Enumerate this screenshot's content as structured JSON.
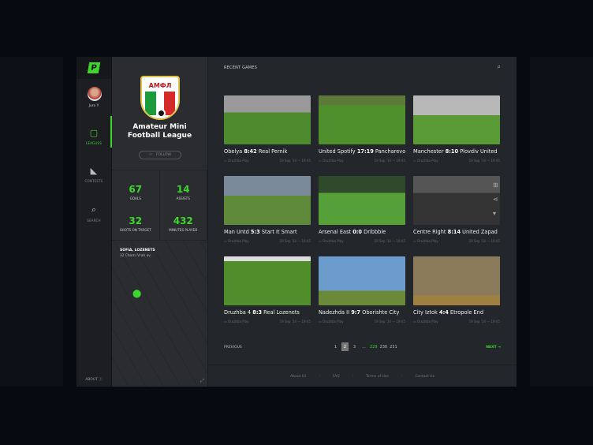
{
  "user": {
    "name": "Juro Y"
  },
  "nav": {
    "leagues": "LEAGUES",
    "contests": "CONTESTS",
    "search": "SEARCH",
    "about": "ABOUT"
  },
  "league": {
    "name_line1": "Amateur Mini",
    "name_line2": "Football League",
    "crest_text": "АМФЛ",
    "follow": "FOLLOW",
    "stats": [
      {
        "value": "67",
        "label": "GOALS"
      },
      {
        "value": "14",
        "label": "ASSISTS"
      },
      {
        "value": "32",
        "label": "SHOTS ON TARGET"
      },
      {
        "value": "432",
        "label": "MINUTES PLAYED"
      }
    ],
    "location": {
      "area": "SOFIA, LOZENETS",
      "address": "32 Cherni Vrah av."
    }
  },
  "main": {
    "title": "RECENT GAMES",
    "games": [
      {
        "home": "Obelya",
        "score": "8:42",
        "away": "Real Pernik",
        "venue": "Druzhba Play",
        "date": "19 Sep '14 — 19:45"
      },
      {
        "home": "United Spotify",
        "score": "17:19",
        "away": "Pancharevo Rangers",
        "venue": "Druzhba Play",
        "date": "19 Sep '14 — 19:45"
      },
      {
        "home": "Manchester",
        "score": "8:10",
        "away": "Plovdiv United",
        "venue": "Druzhba Play",
        "date": "19 Sep '14 — 19:45"
      },
      {
        "home": "Man Untd",
        "score": "5:3",
        "away": "Start It Smart",
        "venue": "Druzhba Play",
        "date": "19 Sep '14 — 19:45"
      },
      {
        "home": "Arsenal East",
        "score": "0:0",
        "away": "Dribbble",
        "venue": "Druzhba Play",
        "date": "19 Sep '14 — 19:45"
      },
      {
        "home": "Centre Right",
        "score": "8:14",
        "away": "United Zapad",
        "venue": "Druzhba Play",
        "date": "19 Sep '14 — 19:45"
      },
      {
        "home": "Druzhba 4",
        "score": "8:3",
        "away": "Real Lozenets",
        "venue": "Druzhba Play",
        "date": "19 Sep '14 — 19:45"
      },
      {
        "home": "Nadezhda II",
        "score": "9:7",
        "away": "Oborishte City",
        "venue": "Druzhba Play",
        "date": "19 Sep '14 — 19:45"
      },
      {
        "home": "City Iztok",
        "score": "4:4",
        "away": "Etropole End",
        "venue": "Druzhba Play",
        "date": "19 Sep '14 — 19:45"
      }
    ],
    "pagination": {
      "previous": "PREVIOUS",
      "next": "NEXT →",
      "pages": [
        "1",
        "2",
        "3",
        "...",
        "229",
        "230",
        "231"
      ],
      "current": "2"
    }
  },
  "footer": [
    "About Us",
    "FAQ",
    "Terms of Use",
    "Contact Us"
  ]
}
